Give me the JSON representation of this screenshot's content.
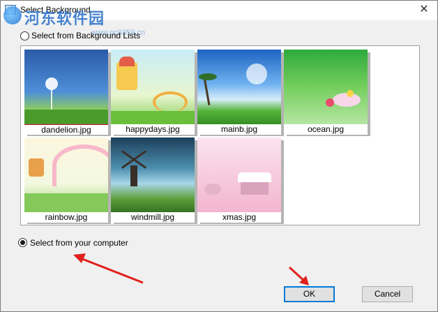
{
  "window": {
    "title": "Select Background",
    "close_glyph": "✕"
  },
  "watermark": {
    "text": "河东软件园",
    "sub": "www.pc0359.cn"
  },
  "options": {
    "from_list_label": "Select from Background Lists",
    "from_computer_label": "Select from your computer",
    "from_list_checked": false,
    "from_computer_checked": true
  },
  "backgrounds": [
    {
      "name": "dandelion.jpg",
      "selected": true
    },
    {
      "name": "happydays.jpg",
      "selected": false
    },
    {
      "name": "mainb.jpg",
      "selected": false
    },
    {
      "name": "ocean.jpg",
      "selected": false
    },
    {
      "name": "rainbow.jpg",
      "selected": false
    },
    {
      "name": "windmill.jpg",
      "selected": false
    },
    {
      "name": "xmas.jpg",
      "selected": false
    }
  ],
  "buttons": {
    "ok": "OK",
    "cancel": "Cancel"
  },
  "colors": {
    "selection": "#c8102e",
    "default_button_border": "#0078d7",
    "annotation_arrow": "#e0201c"
  }
}
